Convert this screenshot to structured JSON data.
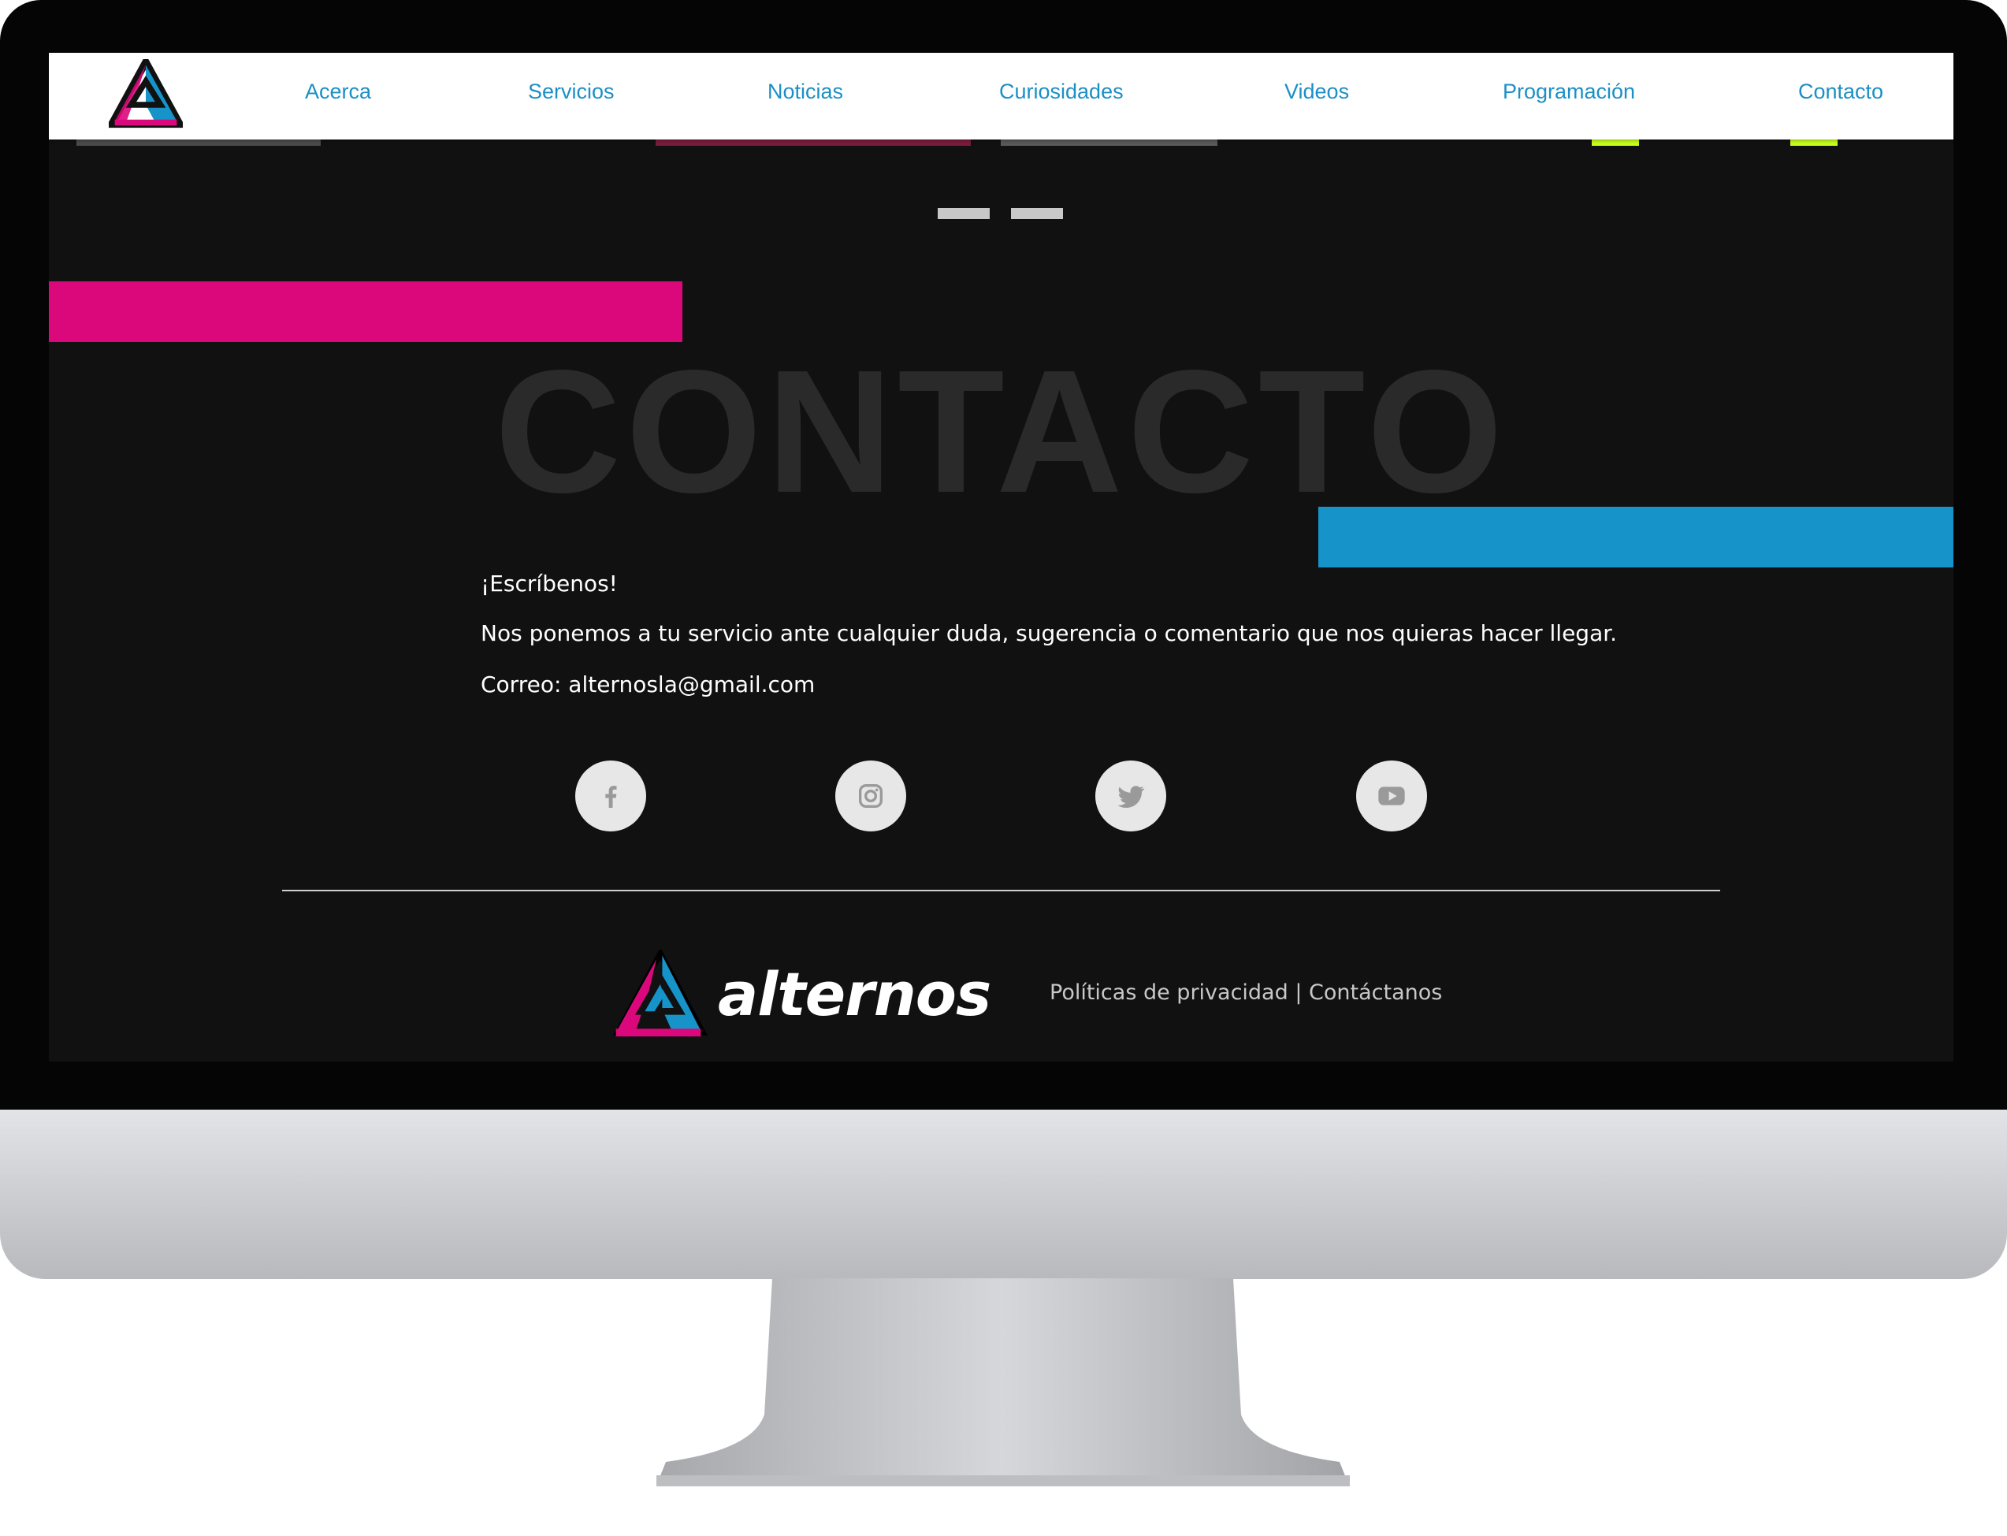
{
  "nav": {
    "items": [
      {
        "label": "Acerca"
      },
      {
        "label": "Servicios"
      },
      {
        "label": "Noticias"
      },
      {
        "label": "Curiosidades"
      },
      {
        "label": "Videos"
      },
      {
        "label": "Programación"
      },
      {
        "label": "Contacto"
      }
    ]
  },
  "hero": {
    "title": "CONTACTO"
  },
  "contact": {
    "heading": "¡Escríbenos!",
    "description": "Nos ponemos a tu servicio ante cualquier duda, sugerencia o comentario que nos quieras hacer llegar.",
    "email_line": "Correo: alternosla@gmail.com"
  },
  "social": {
    "icons": [
      "facebook-icon",
      "instagram-icon",
      "twitter-icon",
      "youtube-icon"
    ]
  },
  "footer": {
    "brand": "alternos",
    "privacy_label": "Políticas de privacidad",
    "separator": "|",
    "contact_label": "Contáctanos"
  },
  "colors": {
    "accent_pink": "#db087b",
    "accent_blue": "#1693c9",
    "page_background": "#111112",
    "nav_link": "#1b8fc6"
  }
}
